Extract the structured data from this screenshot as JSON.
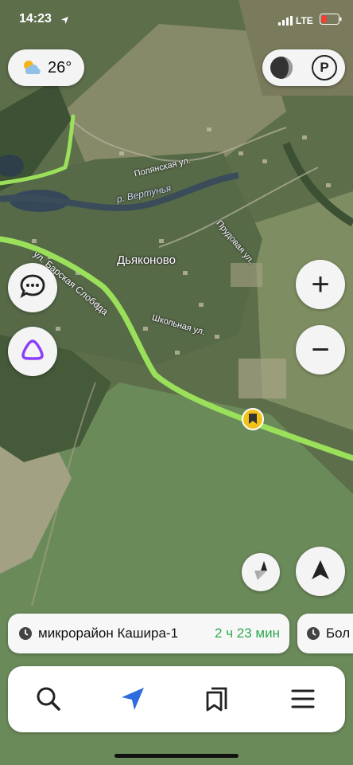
{
  "status": {
    "time": "14:23",
    "network": "LTE"
  },
  "weather": {
    "temperature": "26°",
    "icon": "partly-cloudy-icon"
  },
  "map": {
    "place_name": "Дьяконово",
    "streets": [
      "Полянская ул.",
      "р. Вертунья",
      "Прудовая ул.",
      "ул. Барская Слобода",
      "Школьная ул."
    ]
  },
  "controls": {
    "layers_icon": "layers-icon",
    "parking_label": "P",
    "chat_icon": "chat-icon",
    "alice_icon": "alice-icon",
    "zoom_in": "+",
    "zoom_out": "−",
    "compass_icon": "compass-icon",
    "locate_icon": "navigation-arrow-icon"
  },
  "route": {
    "destination": "микрорайон Кашира-1",
    "duration": "2 ч 23 мин",
    "next_destination": "Бол"
  },
  "tabs": [
    {
      "name": "search",
      "icon": "search-icon"
    },
    {
      "name": "navigator",
      "icon": "navigation-arrow-icon"
    },
    {
      "name": "bookmarks",
      "icon": "bookmarks-icon"
    },
    {
      "name": "menu",
      "icon": "menu-icon"
    }
  ],
  "colors": {
    "route": "#9be05a",
    "duration": "#2fa84f",
    "alice": "#8a3ffc",
    "pin": "#f2c21b"
  }
}
